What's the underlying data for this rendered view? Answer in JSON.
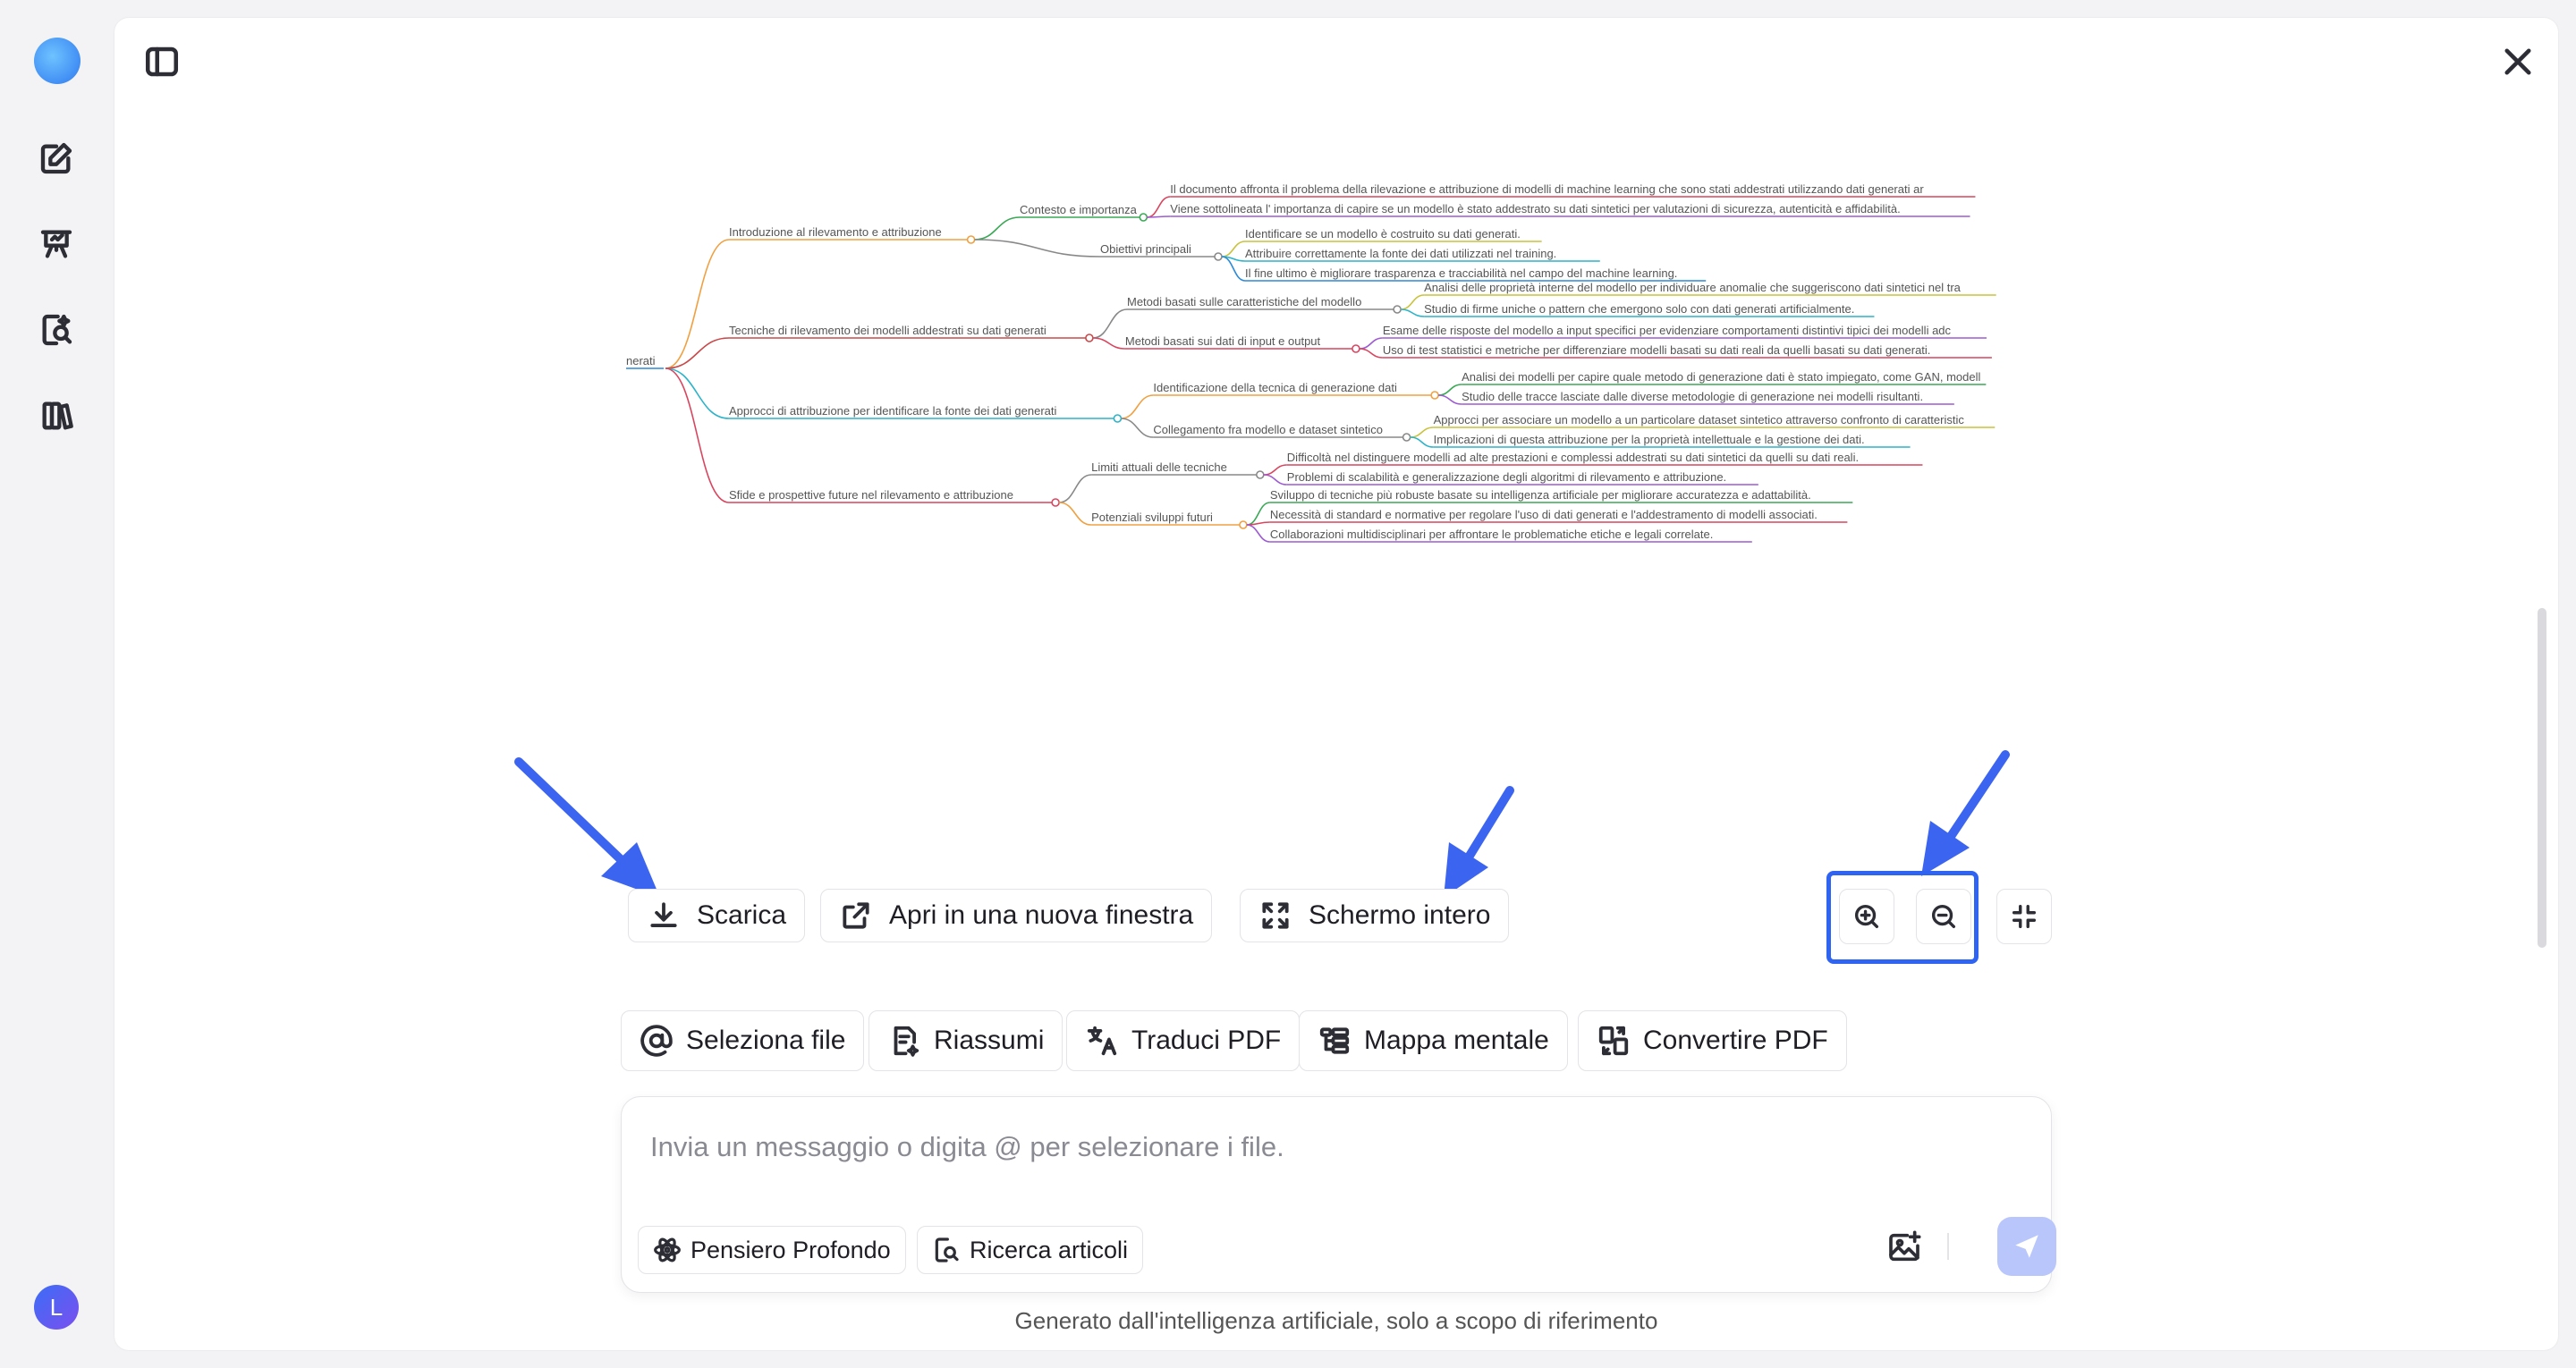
{
  "sidebar": {
    "avatar_initial": "L",
    "icons": [
      "logo-icon",
      "new-chat-icon",
      "presentation-icon",
      "search-document-icon",
      "library-icon"
    ]
  },
  "colors": {
    "accent": "#2f63f2",
    "send_disabled": "#b9c6fb"
  },
  "mindmap": {
    "root": "nerati",
    "branches": [
      {
        "label": "Introduzione al rilevamento e attribuzione",
        "color": "#f0a040",
        "children": [
          {
            "label": "Contesto e importanza",
            "color": "#3aa955",
            "leaves": [
              {
                "text": "Il documento affronta il problema della rilevazione e attribuzione di modelli di machine learning che sono stati addestrati utilizzando dati generati ar",
                "color": "#d9455f"
              },
              {
                "text": "Viene sottolineata l' importanza di capire se un modello è stato addestrato su dati sintetici per valutazioni di sicurezza, autenticità e affidabilità.",
                "color": "#9d5bd2"
              }
            ]
          },
          {
            "label": "Obiettivi principali",
            "color": "#888888",
            "leaves": [
              {
                "text": "Identificare se un modello è costruito su dati generati.",
                "color": "#c9c23a"
              },
              {
                "text": "Attribuire correttamente la fonte dei dati utilizzati nel training.",
                "color": "#2bb3c9"
              },
              {
                "text": "Il fine ultimo è migliorare trasparenza e tracciabilità nel campo del machine learning.",
                "color": "#2b8ad9"
              }
            ]
          }
        ]
      },
      {
        "label": "Tecniche di rilevamento dei modelli addestrati su dati generati",
        "color": "#c94848",
        "children": [
          {
            "label": "Metodi basati sulle caratteristiche del modello",
            "color": "#888888",
            "leaves": [
              {
                "text": "Analisi delle proprietà interne del modello per individuare anomalie che suggeriscono dati sintetici nel tra",
                "color": "#c9c23a"
              },
              {
                "text": "Studio di firme uniche o pattern che emergono solo con dati generati artificialmente.",
                "color": "#2bb3c9"
              }
            ]
          },
          {
            "label": "Metodi basati sui dati di input e output",
            "color": "#d9455f",
            "leaves": [
              {
                "text": "Esame delle risposte del modello a input specifici per evidenziare comportamenti distintivi tipici dei modelli adc",
                "color": "#9d5bd2"
              },
              {
                "text": "Uso di test statistici e metriche per differenziare modelli basati su dati reali da quelli basati su dati generati.",
                "color": "#d9455f"
              }
            ]
          }
        ]
      },
      {
        "label": "Approcci di attribuzione per identificare la fonte dei dati generati",
        "color": "#2bb3c9",
        "children": [
          {
            "label": "Identificazione della tecnica di generazione dati",
            "color": "#f0a040",
            "leaves": [
              {
                "text": "Analisi dei modelli per capire quale metodo di generazione dati è stato impiegato, come GAN, modell",
                "color": "#3aa955"
              },
              {
                "text": "Studio delle tracce lasciate dalle diverse metodologie di generazione nei modelli risultanti.",
                "color": "#9d5bd2"
              }
            ]
          },
          {
            "label": "Collegamento fra modello e dataset sintetico",
            "color": "#888888",
            "leaves": [
              {
                "text": "Approcci per associare un modello a un particolare dataset sintetico attraverso confronto di caratteristic",
                "color": "#c9c23a"
              },
              {
                "text": "Implicazioni di questa attribuzione per la proprietà intellettuale e la gestione dei dati.",
                "color": "#2bb3c9"
              }
            ]
          }
        ]
      },
      {
        "label": "Sfide e prospettive future nel rilevamento e attribuzione",
        "color": "#d9455f",
        "children": [
          {
            "label": "Limiti attuali delle tecniche",
            "color": "#888888",
            "leaves": [
              {
                "text": "Difficoltà nel distinguere modelli ad alte prestazioni e complessi addestrati su dati sintetici da quelli su dati reali.",
                "color": "#d9455f"
              },
              {
                "text": "Problemi di scalabilità e generalizzazione degli algoritmi di rilevamento e attribuzione.",
                "color": "#9d5bd2"
              }
            ]
          },
          {
            "label": "Potenziali sviluppi futuri",
            "color": "#f0a040",
            "leaves": [
              {
                "text": "Sviluppo di tecniche più robuste basate su intelligenza artificiale per migliorare accuratezza e adattabilità.",
                "color": "#3aa955"
              },
              {
                "text": "Necessità di standard e normative per regolare l'uso di dati generati e l'addestramento di modelli associati.",
                "color": "#d9455f"
              },
              {
                "text": "Collaborazioni multidisciplinari per affrontare le problematiche etiche e legali correlate.",
                "color": "#9d5bd2"
              }
            ]
          }
        ]
      }
    ]
  },
  "toolbar": {
    "download": "Scarica",
    "open_new_window": "Apri in una nuova finestra",
    "fullscreen": "Schermo intero"
  },
  "tools": {
    "select_file": "Seleziona file",
    "summarize": "Riassumi",
    "translate": "Traduci PDF",
    "mindmap": "Mappa mentale",
    "convert": "Convertire PDF"
  },
  "chat": {
    "placeholder": "Invia un messaggio o digita @ per selezionare i file.",
    "deep_thinking": "Pensiero Profondo",
    "article_search": "Ricerca articoli"
  },
  "footer": {
    "disclaimer": "Generato dall'intelligenza artificiale, solo a scopo di riferimento"
  }
}
